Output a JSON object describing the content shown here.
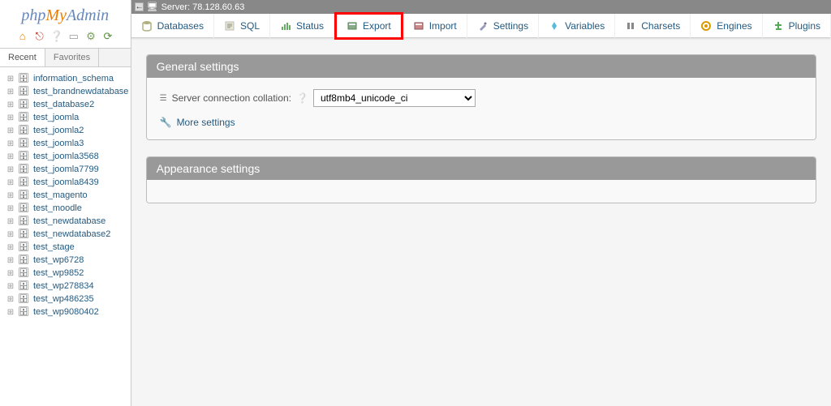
{
  "logo": {
    "part1": "php",
    "part2": "MyAdmin"
  },
  "sidebar": {
    "tabs": {
      "recent": "Recent",
      "favorites": "Favorites"
    },
    "databases": [
      "information_schema",
      "test_brandnewdatabase",
      "test_database2",
      "test_joomla",
      "test_joomla2",
      "test_joomla3",
      "test_joomla3568",
      "test_joomla7799",
      "test_joomla8439",
      "test_magento",
      "test_moodle",
      "test_newdatabase",
      "test_newdatabase2",
      "test_stage",
      "test_wp6728",
      "test_wp9852",
      "test_wp278834",
      "test_wp486235",
      "test_wp9080402"
    ]
  },
  "topbar": {
    "server_label": "Server: 78.128.60.63"
  },
  "tabs": [
    {
      "label": "Databases",
      "icon": "db"
    },
    {
      "label": "SQL",
      "icon": "sql"
    },
    {
      "label": "Status",
      "icon": "status"
    },
    {
      "label": "Export",
      "icon": "export"
    },
    {
      "label": "Import",
      "icon": "import"
    },
    {
      "label": "Settings",
      "icon": "settings"
    },
    {
      "label": "Variables",
      "icon": "variables"
    },
    {
      "label": "Charsets",
      "icon": "charsets"
    },
    {
      "label": "Engines",
      "icon": "engines"
    },
    {
      "label": "Plugins",
      "icon": "plugins"
    }
  ],
  "panels": {
    "general": {
      "title": "General settings",
      "collation_label": "Server connection collation:",
      "collation_value": "utf8mb4_unicode_ci",
      "more_settings": "More settings"
    },
    "appearance": {
      "title": "Appearance settings"
    }
  }
}
